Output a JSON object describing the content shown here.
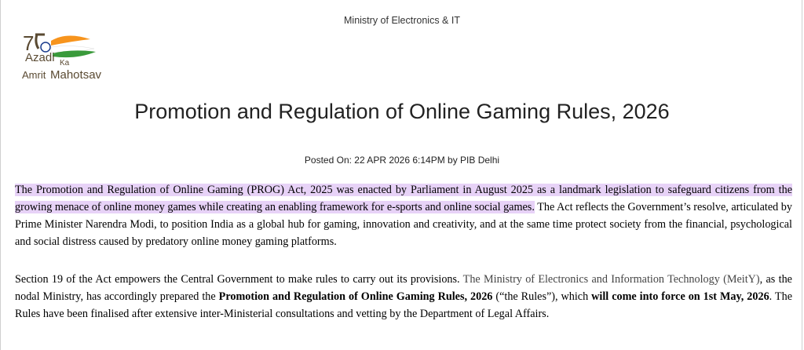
{
  "header": {
    "ministry": "Ministry of Electronics & IT"
  },
  "logo": {
    "number": "75",
    "azadi": "Azadi",
    "ka": "Ka",
    "amrit": "Amrit",
    "mahotsav": "Mahotsav",
    "colors": {
      "saffron": "#f7941d",
      "green": "#3a9a3b",
      "text": "#5a4a32"
    }
  },
  "article": {
    "title": "Promotion and Regulation of Online Gaming Rules, 2026",
    "posted": "Posted On: 22 APR 2026 6:14PM by PIB Delhi",
    "highlight_color": "#e7d2f7",
    "p1": {
      "highlighted": "The Promotion and Regulation of Online Gaming (PROG) Act, 2025 was enacted by Parliament in August 2025 as a landmark legislation to safeguard citizens from the growing menace of online money games while creating an enabling framework for e-sports and online social games.",
      "rest": " The Act reflects the Government’s resolve, articulated by Prime Minister Narendra Modi, to position India as a global hub for gaming, innovation and creativity, and at the same time protect society from the financial, psychological and social distress caused by predatory online money gaming platforms."
    },
    "p2": {
      "s1": "Section 19 of the Act empowers the Central Government to make rules to carry out its provisions.",
      "s2_dim": " The Ministry of Elec",
      "s2_norm": "tronics and Information Technology",
      "s2_dim2": " (MeitY)",
      "s3": ", as the nodal Ministry, has accordingly prepared the ",
      "rules_bold": "Promotion and Regulation of Online Gaming Rules, 2026",
      "s4": " (“the Rules”), which ",
      "force_bold": "will come into force on 1st May, 2026",
      "s5": ". The Rules have been finalised after extensive inter-Ministerial consultations and vetting by the Department of Legal Affairs."
    }
  }
}
